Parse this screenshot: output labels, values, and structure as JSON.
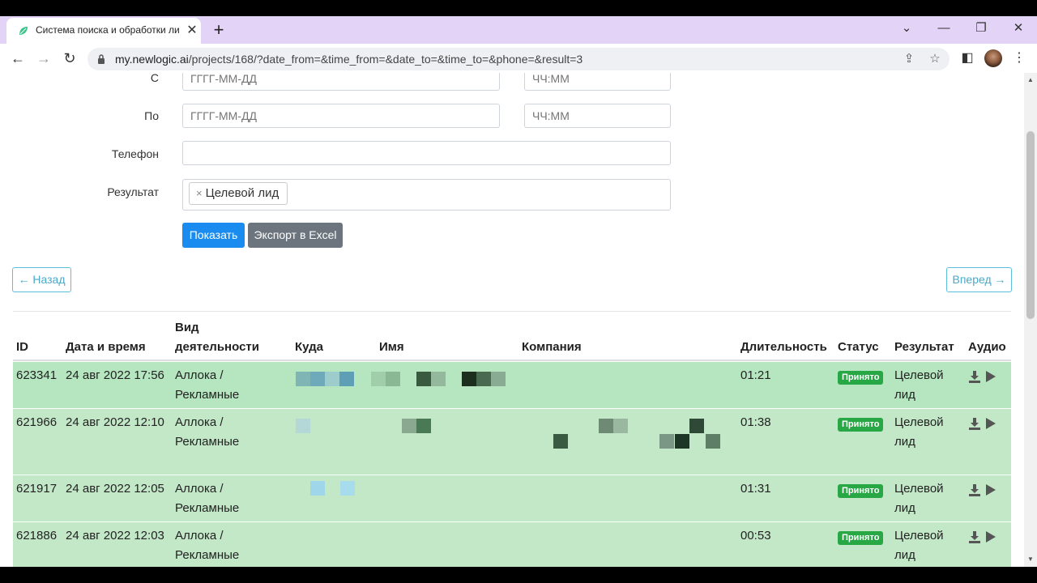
{
  "browser": {
    "tab_title": "Система поиска и обработки ли",
    "url_host": "my.newlogic.ai",
    "url_path": "/projects/168/?date_from=&time_from=&date_to=&time_to=&phone=&result=3"
  },
  "filters": {
    "from_label": "С",
    "to_label": "По",
    "phone_label": "Телефон",
    "result_label": "Результат",
    "date_placeholder": "ГГГГ-ММ-ДД",
    "time_placeholder": "ЧЧ:ММ",
    "selected_result": "Целевой лид",
    "chip_remove": "×",
    "show_button": "Показать",
    "export_button": "Экспорт в Excel"
  },
  "pagination": {
    "prev": "← Назад",
    "next": "Вперед →"
  },
  "table": {
    "headers": {
      "id": "ID",
      "datetime": "Дата и время",
      "activity_1": "Вид",
      "activity_2": "деятельности",
      "dest": "Куда",
      "name": "Имя",
      "company": "Компания",
      "duration": "Длительность",
      "status": "Статус",
      "result": "Результат",
      "audio": "Аудио"
    },
    "rows": [
      {
        "id": "623341",
        "datetime": "24 авг 2022 17:56",
        "activity_1": "Аллока /",
        "activity_2": "Рекламные",
        "duration": "01:21",
        "status": "Принято",
        "result_1": "Целевой",
        "result_2": "лид"
      },
      {
        "id": "621966",
        "datetime": "24 авг 2022 12:10",
        "activity_1": "Аллока /",
        "activity_2": "Рекламные",
        "duration": "01:38",
        "status": "Принято",
        "result_1": "Целевой",
        "result_2": "лид"
      },
      {
        "id": "621917",
        "datetime": "24 авг 2022 12:05",
        "activity_1": "Аллока /",
        "activity_2": "Рекламные",
        "duration": "01:31",
        "status": "Принято",
        "result_1": "Целевой",
        "result_2": "лид"
      },
      {
        "id": "621886",
        "datetime": "24 авг 2022 12:03",
        "activity_1": "Аллока /",
        "activity_2": "Рекламные",
        "duration": "00:53",
        "status": "Принято",
        "result_1": "Целевой",
        "result_2": "лид"
      }
    ]
  },
  "colors": {
    "tabstrip": "#e2d3f7",
    "row_green": "#b5e6bf",
    "badge_green": "#28a745",
    "primary": "#1a8cf0",
    "secondary": "#6c757d",
    "info": "#5bc0de"
  },
  "icons": [
    "leaf-favicon-icon",
    "close-icon",
    "plus-icon",
    "chevron-down-icon",
    "minimize-icon",
    "restore-icon",
    "window-close-icon",
    "back-arrow-icon",
    "forward-arrow-icon",
    "reload-icon",
    "lock-icon",
    "share-icon",
    "star-icon",
    "side-panel-icon",
    "kebab-menu-icon",
    "download-icon",
    "play-icon"
  ]
}
